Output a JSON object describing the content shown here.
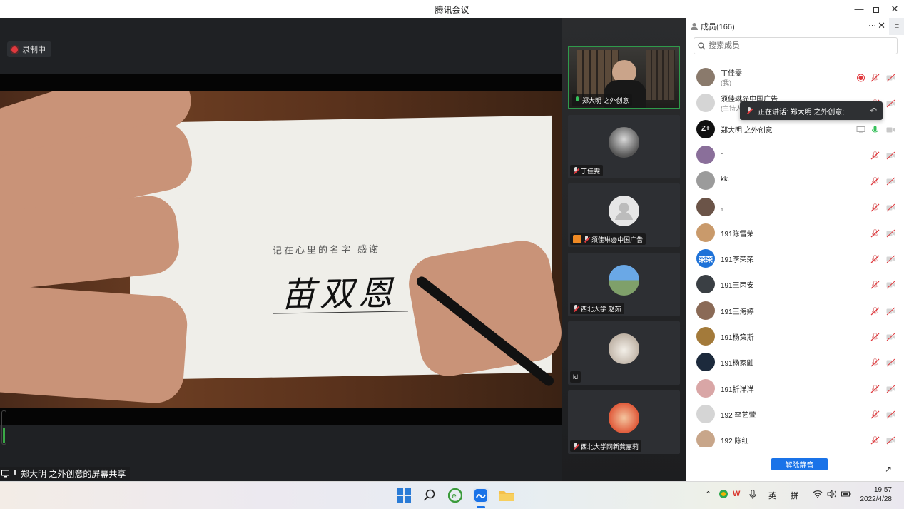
{
  "window": {
    "title": "腾讯会议"
  },
  "share": {
    "recording_label": "录制中",
    "card_caption": "记在心里的名字   感谢",
    "card_signature": "苗双恩",
    "sharer_caption": "郑大明 之外创意的屏幕共享"
  },
  "video_tiles": [
    {
      "name": "郑大明 之外创意",
      "active": true,
      "mic": "on"
    },
    {
      "name": "丁佳雯",
      "active": false,
      "mic": "muted"
    },
    {
      "name": "须佳琳@中国广告",
      "active": false,
      "mic": "muted",
      "host_badge": true
    },
    {
      "name": "西北大学 赵茹",
      "active": false,
      "mic": "muted"
    },
    {
      "name": "ld",
      "active": false,
      "mic": "none"
    },
    {
      "name": "西北大学网新龚嘉莉",
      "active": false,
      "mic": "muted"
    }
  ],
  "members": {
    "title": "成员(166)",
    "search_placeholder": "搜索成员",
    "speaking_banner": "正在讲话: 郑大明 之外创意;",
    "unmute_all_label": "解除静音",
    "list": [
      {
        "name": "丁佳雯",
        "sub": "(我)",
        "avatar_color": "#8a7a6c",
        "avatar_text": "",
        "recording": true,
        "mic": "muted"
      },
      {
        "name": "须佳琳@中国广告",
        "sub": "(主持人)",
        "avatar_color": "#d5d5d5",
        "avatar_text": "",
        "recording": false,
        "mic": "muted"
      },
      {
        "name": "郑大明 之外创意",
        "sub": "",
        "avatar_color": "#111111",
        "avatar_text": "Z+",
        "recording": false,
        "mic": "on",
        "screen": true
      },
      {
        "name": "-",
        "sub": "",
        "avatar_color": "#8a6f9a",
        "avatar_text": "",
        "recording": false,
        "mic": "muted"
      },
      {
        "name": "kk.",
        "sub": "",
        "avatar_color": "#9b9b9b",
        "avatar_text": "",
        "recording": false,
        "mic": "muted"
      },
      {
        "name": "。",
        "sub": "",
        "avatar_color": "#6b5448",
        "avatar_text": "",
        "recording": false,
        "mic": "muted"
      },
      {
        "name": "191陈雪荣",
        "sub": "",
        "avatar_color": "#c99a6b",
        "avatar_text": "",
        "recording": false,
        "mic": "muted"
      },
      {
        "name": "191李荣荣",
        "sub": "",
        "avatar_color": "#1e72d8",
        "avatar_text": "荣荣",
        "recording": false,
        "mic": "muted"
      },
      {
        "name": "191王丙安",
        "sub": "",
        "avatar_color": "#3a3f44",
        "avatar_text": "",
        "recording": false,
        "mic": "muted"
      },
      {
        "name": "191王海婷",
        "sub": "",
        "avatar_color": "#8a6a56",
        "avatar_text": "",
        "recording": false,
        "mic": "muted"
      },
      {
        "name": "191杨策斯",
        "sub": "",
        "avatar_color": "#a37a3a",
        "avatar_text": "",
        "recording": false,
        "mic": "muted"
      },
      {
        "name": "191杨家鼬",
        "sub": "",
        "avatar_color": "#1c2a3c",
        "avatar_text": "",
        "recording": false,
        "mic": "muted"
      },
      {
        "name": "191折洋洋",
        "sub": "",
        "avatar_color": "#d9a6a6",
        "avatar_text": "",
        "recording": false,
        "mic": "muted"
      },
      {
        "name": "192  李艺萱",
        "sub": "",
        "avatar_color": "#d5d5d5",
        "avatar_text": "",
        "recording": false,
        "mic": "muted"
      },
      {
        "name": "192 陈红",
        "sub": "",
        "avatar_color": "#c8a68a",
        "avatar_text": "",
        "recording": false,
        "mic": "muted"
      }
    ]
  },
  "taskbar": {
    "ime_lang": "英",
    "ime_mode": "拼",
    "time": "19:57",
    "date": "2022/4/28"
  },
  "colors": {
    "accent": "#1a73e8",
    "active_green": "#2f9a4b",
    "record_red": "#e0393e",
    "muted_red": "#e0393e"
  }
}
